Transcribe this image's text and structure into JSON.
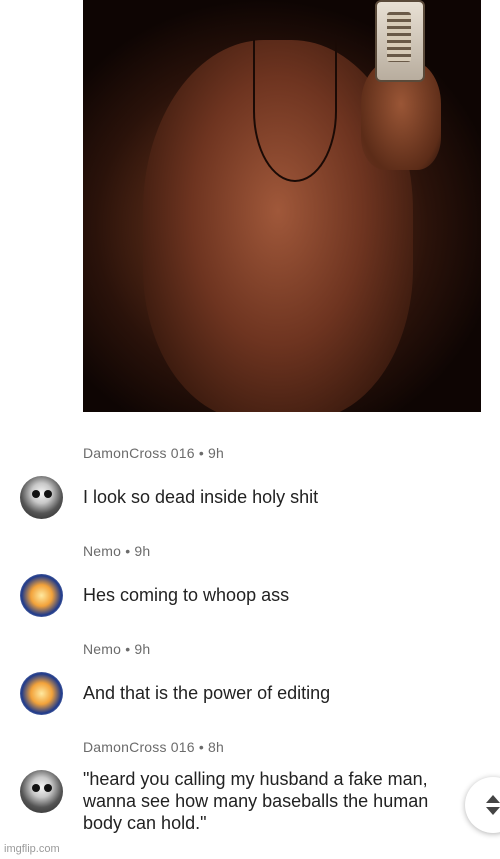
{
  "comments": [
    {
      "meta": "DamonCross 016 • 9h",
      "text": "I look so dead inside holy shit"
    },
    {
      "meta": "Nemo • 9h",
      "text": "Hes coming to whoop ass"
    },
    {
      "meta": "Nemo • 9h",
      "text": "And that is the power of editing"
    },
    {
      "meta": "DamonCross 016 • 8h",
      "text_lines": [
        "\"heard you calling my husband a fake man,",
        "wanna see how many baseballs the human",
        "body can hold.\""
      ]
    }
  ],
  "watermark": "imgflip.com",
  "icons": {
    "scroll": "up-down-arrows-icon"
  }
}
